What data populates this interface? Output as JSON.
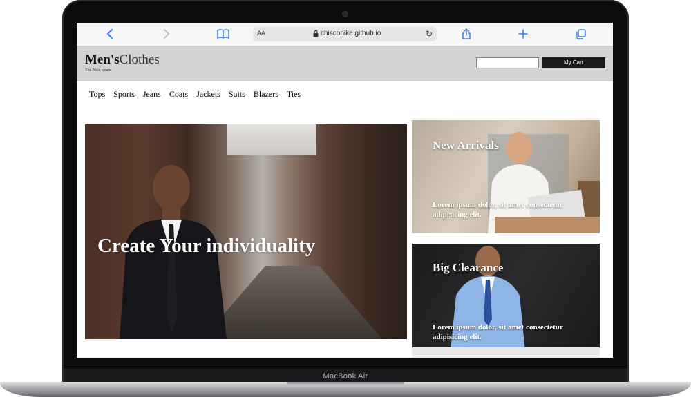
{
  "device": {
    "label": "MacBook Air"
  },
  "browser": {
    "aa_label": "AA",
    "url": "chisconike.github.io"
  },
  "site": {
    "logo_bold": "Men's",
    "logo_light": "Clothes",
    "tagline": "The Nice wears",
    "search_value": "",
    "cart_label": "My Cart"
  },
  "nav": {
    "items": [
      "Tops",
      "Sports",
      "Jeans",
      "Coats",
      "Jackets",
      "Suits",
      "Blazers",
      "Ties"
    ]
  },
  "hero": {
    "title": "Create Your individuality"
  },
  "cards": [
    {
      "title": "New Arrivals",
      "text": "Lorem ipsum dolor, sit amet consectetur adipisicing elit."
    },
    {
      "title": "Big Clearance",
      "text": "Lorem ipsum dolor, sit amet consectetur adipisicing elit."
    }
  ],
  "colors": {
    "header_bg": "#d3d3d3",
    "cart_bg": "#1b1b1b",
    "toolbar_accent": "#3b82f6"
  }
}
